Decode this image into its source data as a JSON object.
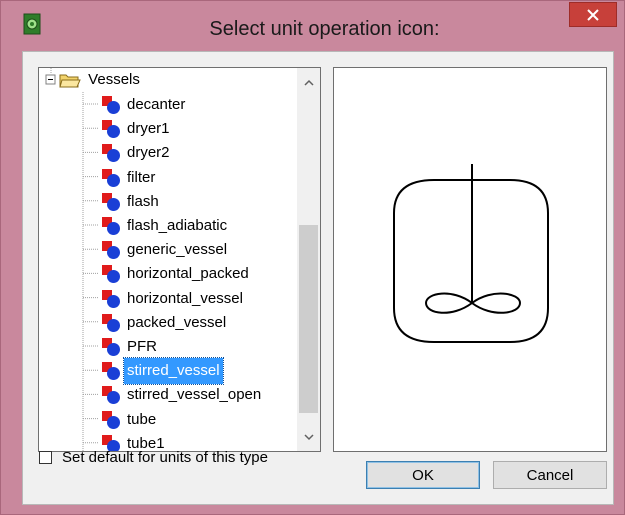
{
  "window": {
    "title": "Select unit operation icon:",
    "icons": {
      "app": "app-icon",
      "close": "close-icon"
    }
  },
  "tree": {
    "root": {
      "label": "Vessels",
      "icon": "folder-open-icon",
      "expanded": true
    },
    "items": [
      {
        "label": "decanter"
      },
      {
        "label": "dryer1"
      },
      {
        "label": "dryer2"
      },
      {
        "label": "filter"
      },
      {
        "label": "flash"
      },
      {
        "label": "flash_adiabatic"
      },
      {
        "label": "generic_vessel"
      },
      {
        "label": "horizontal_packed"
      },
      {
        "label": "horizontal_vessel"
      },
      {
        "label": "packed_vessel"
      },
      {
        "label": "PFR"
      },
      {
        "label": "stirred_vessel",
        "selected": true
      },
      {
        "label": "stirred_vessel_open"
      },
      {
        "label": "tube"
      },
      {
        "label": "tube1"
      }
    ],
    "item_icon": "unit-operation-icon",
    "selection_color": "#3399ff"
  },
  "preview": {
    "icon": "stirred-vessel-preview-icon"
  },
  "options": {
    "set_default_label": "Set default for units of this type",
    "set_default_checked": false
  },
  "buttons": {
    "ok_label": "OK",
    "cancel_label": "Cancel"
  }
}
